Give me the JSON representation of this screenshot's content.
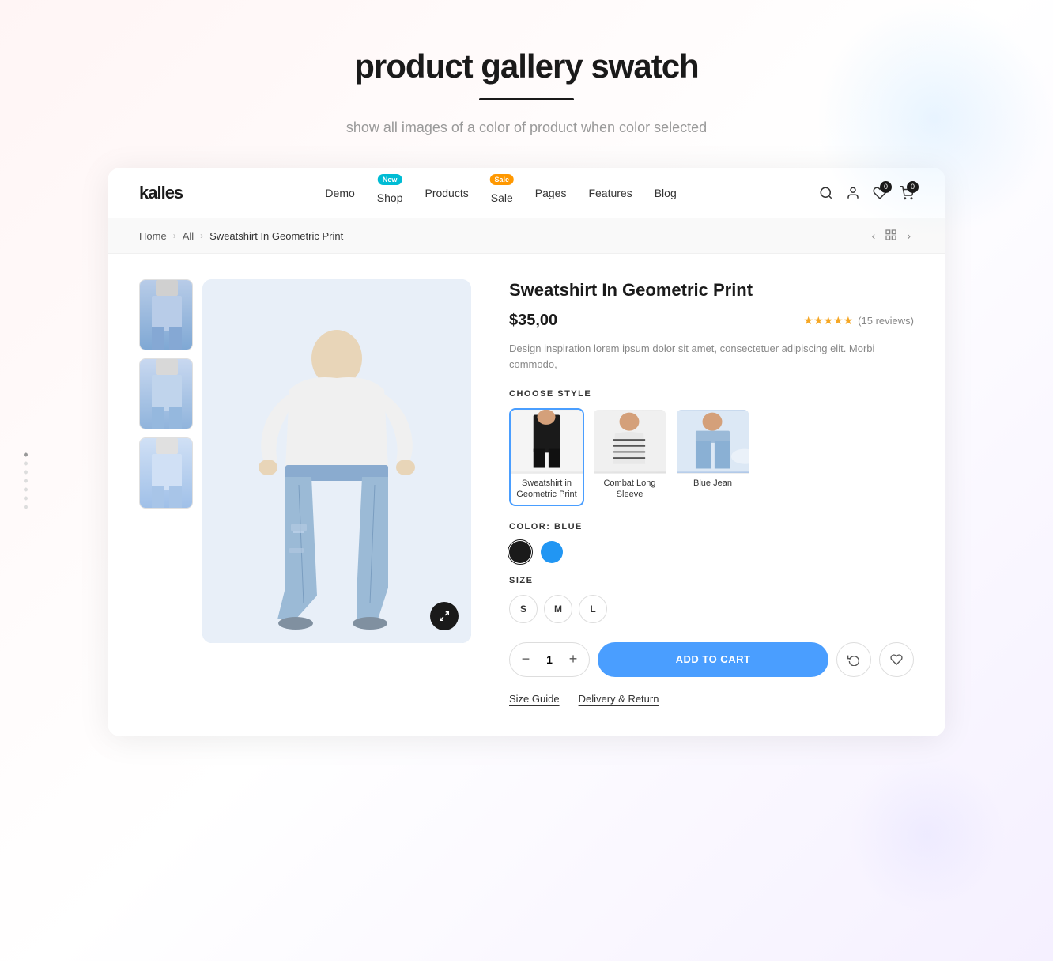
{
  "page": {
    "title": "product gallery swatch",
    "underline": true,
    "subtitle": "show all images of a color of product when color selected"
  },
  "nav": {
    "logo": "kalles",
    "links": [
      {
        "label": "Demo",
        "badge": null
      },
      {
        "label": "Shop",
        "badge": {
          "text": "New",
          "type": "new"
        }
      },
      {
        "label": "Products",
        "badge": null
      },
      {
        "label": "Sale",
        "badge": {
          "text": "Sale",
          "type": "sale"
        }
      },
      {
        "label": "Pages",
        "badge": null
      },
      {
        "label": "Features",
        "badge": null
      },
      {
        "label": "Blog",
        "badge": null
      }
    ],
    "cart_count": "0",
    "wishlist_count": "0"
  },
  "breadcrumb": {
    "items": [
      {
        "label": "Home",
        "active": false
      },
      {
        "label": "All",
        "active": false
      },
      {
        "label": "Sweatshirt In Geometric Print",
        "active": true
      }
    ]
  },
  "product": {
    "name": "Sweatshirt In Geometric Print",
    "price": "$35,00",
    "rating": {
      "stars": 5,
      "count": "15 reviews"
    },
    "description": "Design inspiration lorem ipsum dolor sit amet, consectetuer adipiscing elit. Morbi commodo,",
    "style_label": "CHOOSE STYLE",
    "styles": [
      {
        "label": "Sweatshirt in Geometric Print",
        "selected": true,
        "bg": "black-pants"
      },
      {
        "label": "Combat Long Sleeve",
        "selected": false,
        "bg": "stripe-top"
      },
      {
        "label": "Blue Jean",
        "selected": false,
        "bg": "blue-jeans"
      }
    ],
    "color_label": "COLOR: BLUE",
    "colors": [
      {
        "value": "#1a1a1a",
        "label": "black",
        "selected": false
      },
      {
        "value": "#2196F3",
        "label": "blue",
        "selected": true
      }
    ],
    "size_label": "SIZE",
    "sizes": [
      "S",
      "M",
      "L"
    ],
    "quantity": 1,
    "add_to_cart": "ADD TO CART",
    "links": [
      {
        "label": "Size Guide"
      },
      {
        "label": "Delivery & Return"
      }
    ]
  },
  "icons": {
    "search": "🔍",
    "user": "👤",
    "wishlist": "♡",
    "cart": "🛒",
    "zoom": "⤢",
    "refresh": "↺",
    "heart": "♡",
    "chevron_left": "‹",
    "chevron_right": "›",
    "grid": "⊞",
    "minus": "−",
    "plus": "+"
  }
}
